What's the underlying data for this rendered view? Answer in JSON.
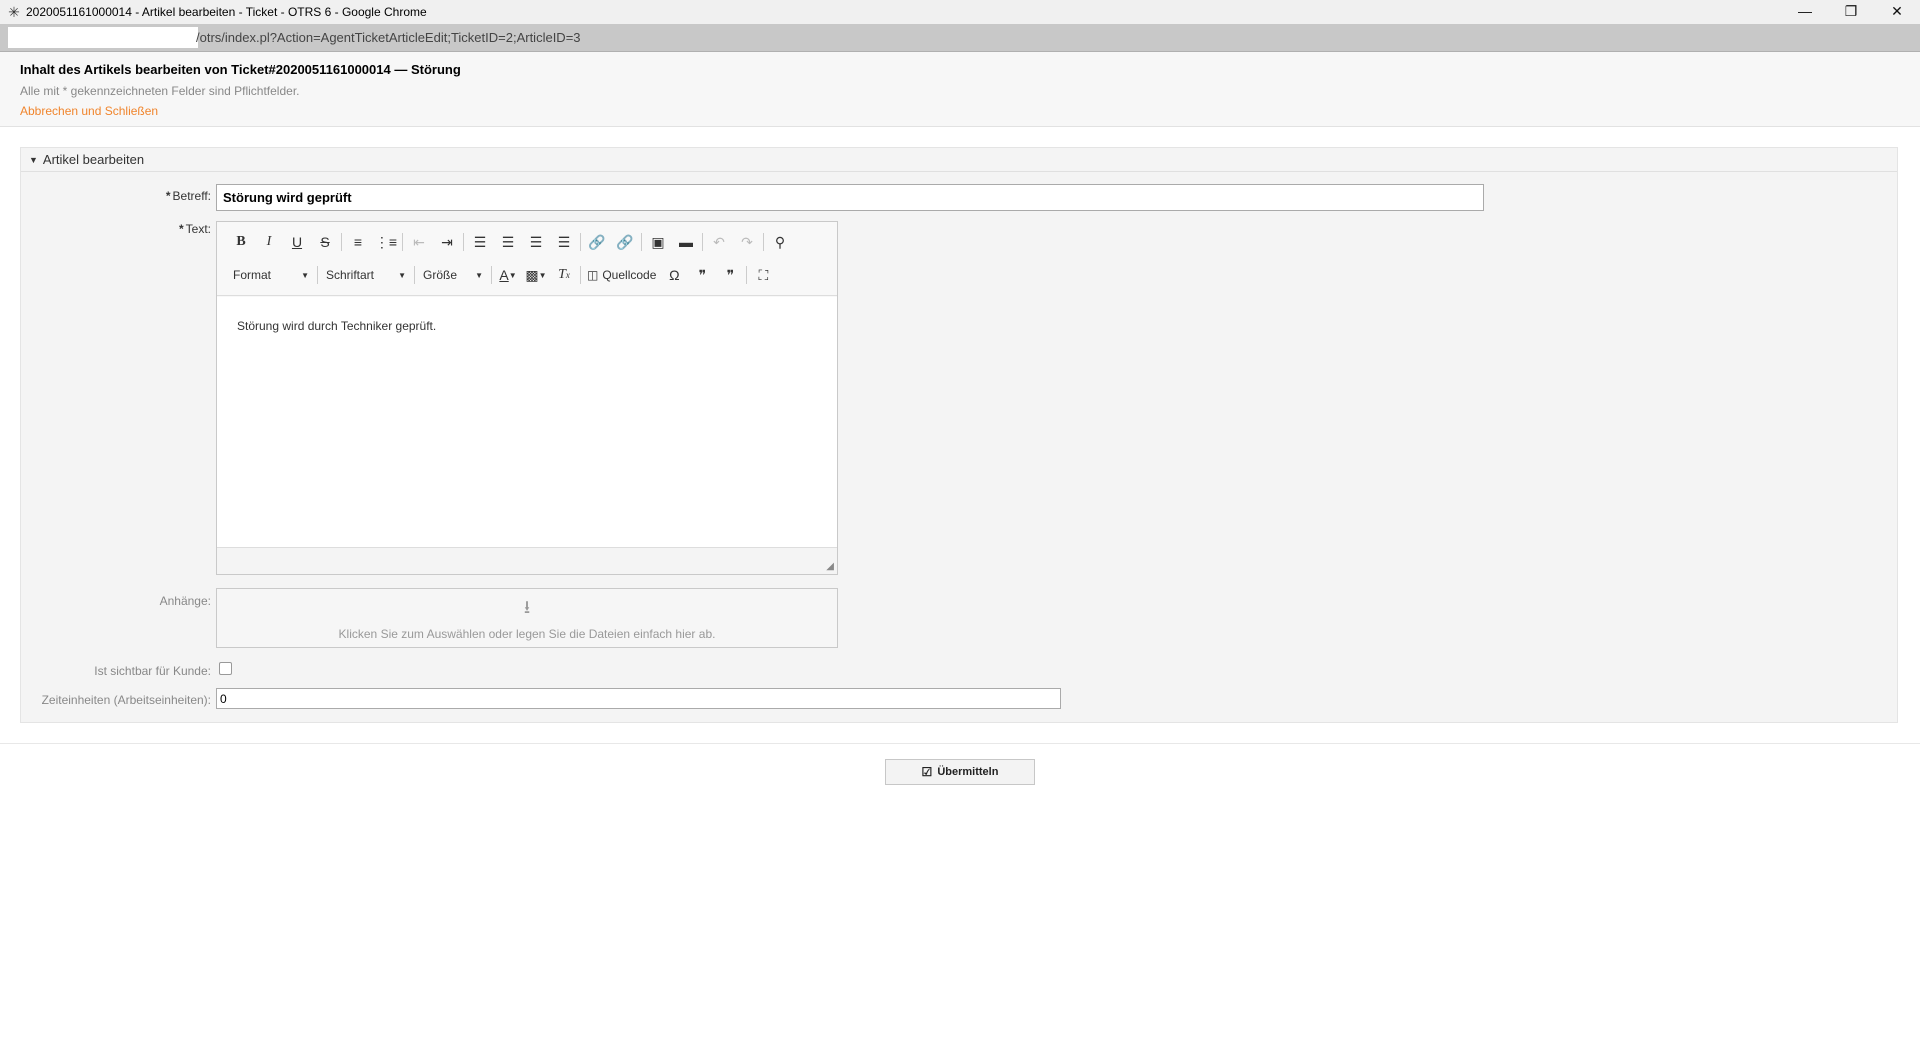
{
  "window": {
    "title": "2020051161000014 - Artikel bearbeiten - Ticket - OTRS 6 - Google Chrome",
    "minimize_icon": "minimize-icon",
    "maximize_icon": "restore-icon",
    "close_icon": "close-icon"
  },
  "addressbar": {
    "url": "/otrs/index.pl?Action=AgentTicketArticleEdit;TicketID=2;ArticleID=3"
  },
  "header": {
    "title": "Inhalt des Artikels bearbeiten von Ticket#2020051161000014 — Störung",
    "required_hint": "Alle mit * gekennzeichneten Felder sind Pflichtfelder.",
    "cancel_link": "Abbrechen und Schließen"
  },
  "widget": {
    "title": "Artikel bearbeiten"
  },
  "form": {
    "subject_label": "Betreff:",
    "subject_value": "Störung wird geprüft",
    "text_label": "Text:",
    "body_text": "Störung wird durch Techniker geprüft.",
    "attachments_label": "Anhänge:",
    "dropzone_text": "Klicken Sie zum Auswählen oder legen Sie die Dateien einfach hier ab.",
    "visible_label": "Ist sichtbar für Kunde:",
    "visible_checked": false,
    "time_label": "Zeiteinheiten (Arbeitseinheiten):",
    "time_value": "0",
    "submit_label": "Übermitteln",
    "required_mark": "*"
  },
  "editor": {
    "format_combo": "Format",
    "font_combo": "Schriftart",
    "size_combo": "Größe",
    "source_button": "Quellcode"
  }
}
